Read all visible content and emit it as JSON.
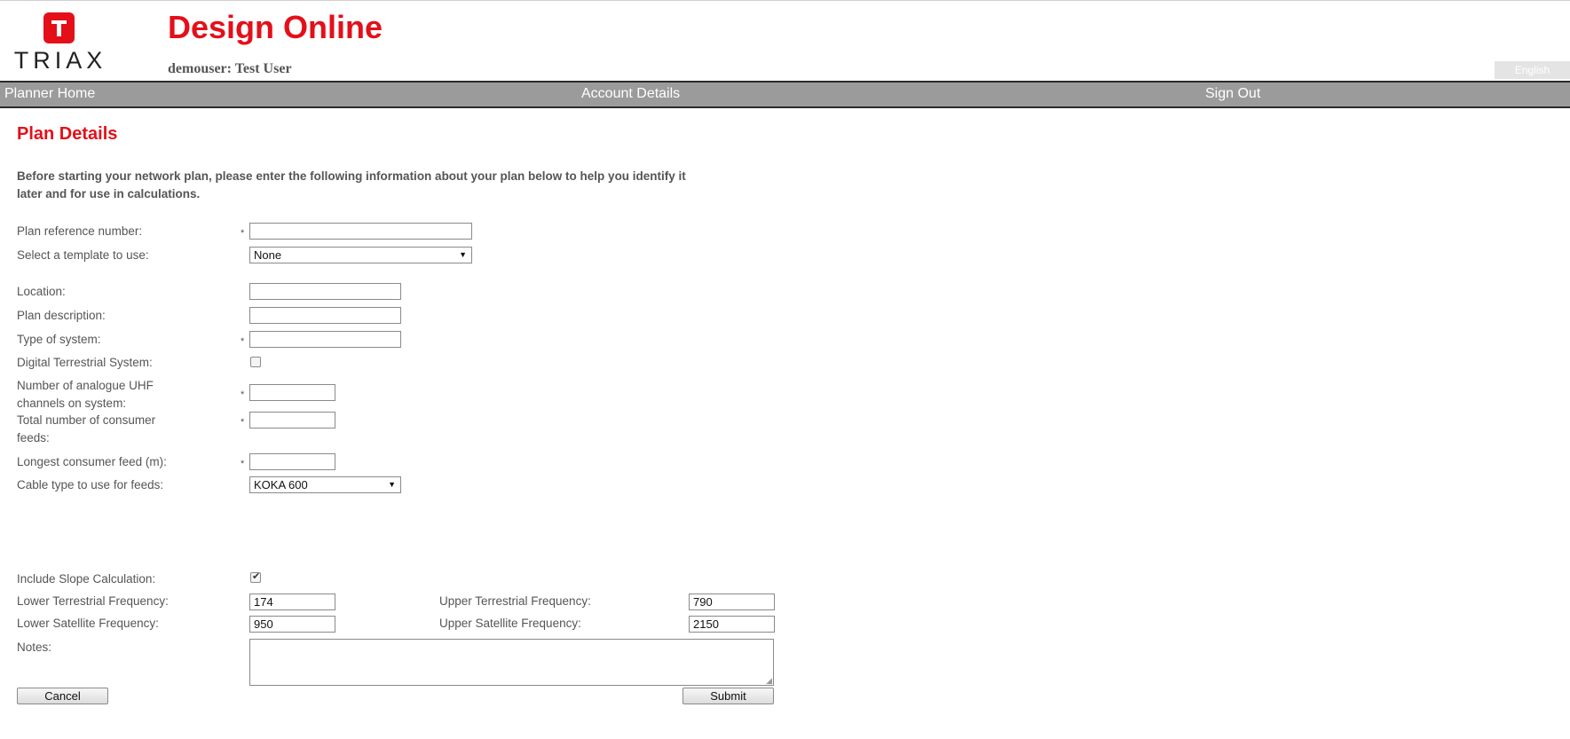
{
  "brand": {
    "logo_text": "TRIAX",
    "app_title": "Design Online",
    "user_line": "demouser: Test User",
    "language_label": "English",
    "accent_color": "#e3101a"
  },
  "nav": {
    "home": "Planner Home",
    "account": "Account Details",
    "sign_out": "Sign Out"
  },
  "page": {
    "heading": "Plan Details",
    "intro": "Before starting your network plan, please enter the following information about your plan below to help you identify it later and for use in calculations."
  },
  "form": {
    "required_marker": "*",
    "plan_ref": {
      "label": "Plan reference number:",
      "value": ""
    },
    "template": {
      "label": "Select a template to use:",
      "selected": "None"
    },
    "location": {
      "label": "Location:",
      "value": ""
    },
    "description": {
      "label": "Plan description:",
      "value": ""
    },
    "system_type": {
      "label": "Type of system:",
      "value": ""
    },
    "digital_terrestrial": {
      "label": "Digital Terrestrial System:",
      "checked": false
    },
    "analogue_channels": {
      "label": "Number of analogue UHF channels on system:",
      "value": ""
    },
    "consumer_feeds": {
      "label": "Total number of consumer feeds:",
      "value": ""
    },
    "longest_feed": {
      "label": "Longest consumer feed (m):",
      "value": ""
    },
    "cable_type": {
      "label": "Cable type to use for feeds:",
      "selected": "KOKA 600"
    },
    "slope_calc": {
      "label": "Include Slope Calculation:",
      "checked": true
    },
    "lower_terrestrial": {
      "label": "Lower Terrestrial Frequency:",
      "value": "174"
    },
    "upper_terrestrial": {
      "label": "Upper Terrestrial Frequency:",
      "value": "790"
    },
    "lower_satellite": {
      "label": "Lower Satellite Frequency:",
      "value": "950"
    },
    "upper_satellite": {
      "label": "Upper Satellite Frequency:",
      "value": "2150"
    },
    "notes": {
      "label": "Notes:",
      "value": ""
    },
    "cancel_label": "Cancel",
    "submit_label": "Submit"
  }
}
